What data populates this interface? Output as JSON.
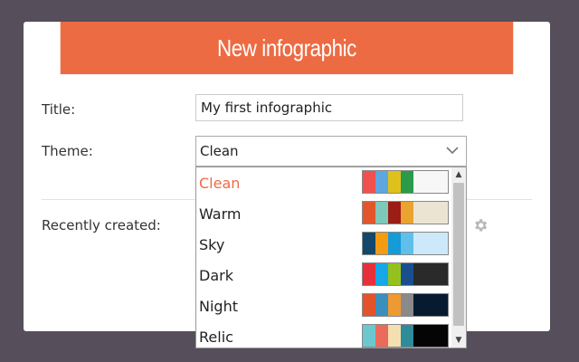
{
  "dialog": {
    "title": "New infographic",
    "title_label": "Title:",
    "title_value": "My first infographic",
    "theme_label": "Theme:",
    "theme_selected": "Clean",
    "recent_label": "Recently created:"
  },
  "colors": {
    "accent": "#ec6b43",
    "backdrop": "#564e5a"
  },
  "themes": [
    {
      "name": "Clean",
      "swatches": [
        "#f0504e",
        "#5ea6e0",
        "#e0c11b",
        "#299b4a"
      ],
      "base": "#f7f7f7",
      "selected": true
    },
    {
      "name": "Warm",
      "swatches": [
        "#e3562c",
        "#7ec9b9",
        "#9b1d16",
        "#e9a331"
      ],
      "base": "#ece4d2",
      "selected": false
    },
    {
      "name": "Sky",
      "swatches": [
        "#12486c",
        "#f39c12",
        "#169ad8",
        "#5ec0ea"
      ],
      "base": "#cde9f9",
      "selected": false
    },
    {
      "name": "Dark",
      "swatches": [
        "#e8303b",
        "#16a7e6",
        "#95c11f",
        "#1a4f8f"
      ],
      "base": "#2a2a2a",
      "selected": false
    },
    {
      "name": "Night",
      "swatches": [
        "#e2532b",
        "#3b8fbd",
        "#ee9a33",
        "#8a8a8a"
      ],
      "base": "#061a30",
      "selected": false
    },
    {
      "name": "Relic",
      "swatches": [
        "#6cc8cf",
        "#eb6b5a",
        "#f4dfb1",
        "#2d8b9a"
      ],
      "base": "#050505",
      "selected": false
    }
  ],
  "icons": {
    "dropdown_arrow": "chevron-down-icon",
    "settings": "gear-icon",
    "scroll_up": "scroll-up-arrow-icon",
    "scroll_down": "scroll-down-arrow-icon"
  }
}
